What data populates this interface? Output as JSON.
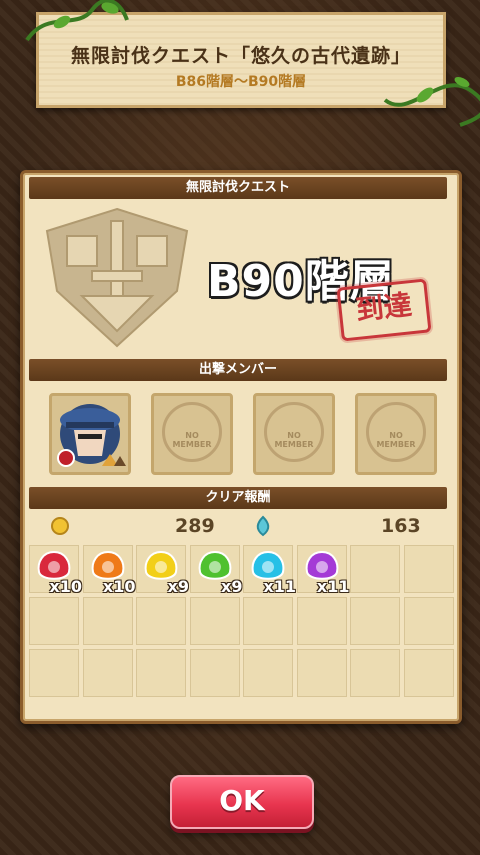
{
  "banner": {
    "title": "無限討伐クエスト「悠久の古代遺跡」",
    "subtitle": "B86階層〜B90階層"
  },
  "panel": {
    "quest_header": "無限討伐クエスト",
    "floor": "B90階層",
    "stamp": "到達",
    "members_header": "出撃メンバー",
    "members": [
      {
        "type": "character",
        "icon": "character-portrait-icon"
      },
      {
        "type": "empty",
        "label": "NO MEMBER"
      },
      {
        "type": "empty",
        "label": "NO MEMBER"
      },
      {
        "type": "empty",
        "label": "NO MEMBER"
      }
    ],
    "rewards_header": "クリア報酬",
    "coins": "289",
    "soul": "163",
    "items": [
      {
        "name": "red-gem-icon",
        "color": "#d9283c",
        "qty": "x10"
      },
      {
        "name": "orange-gem-icon",
        "color": "#ef7a18",
        "qty": "x10"
      },
      {
        "name": "yellow-gem-icon",
        "color": "#f2cf18",
        "qty": "x9"
      },
      {
        "name": "green-gem-icon",
        "color": "#4fc12f",
        "qty": "x9"
      },
      {
        "name": "cyan-gem-icon",
        "color": "#27c0e6",
        "qty": "x11"
      },
      {
        "name": "purple-gem-icon",
        "color": "#a43ad6",
        "qty": "x11"
      }
    ]
  },
  "ok_button": "OK"
}
